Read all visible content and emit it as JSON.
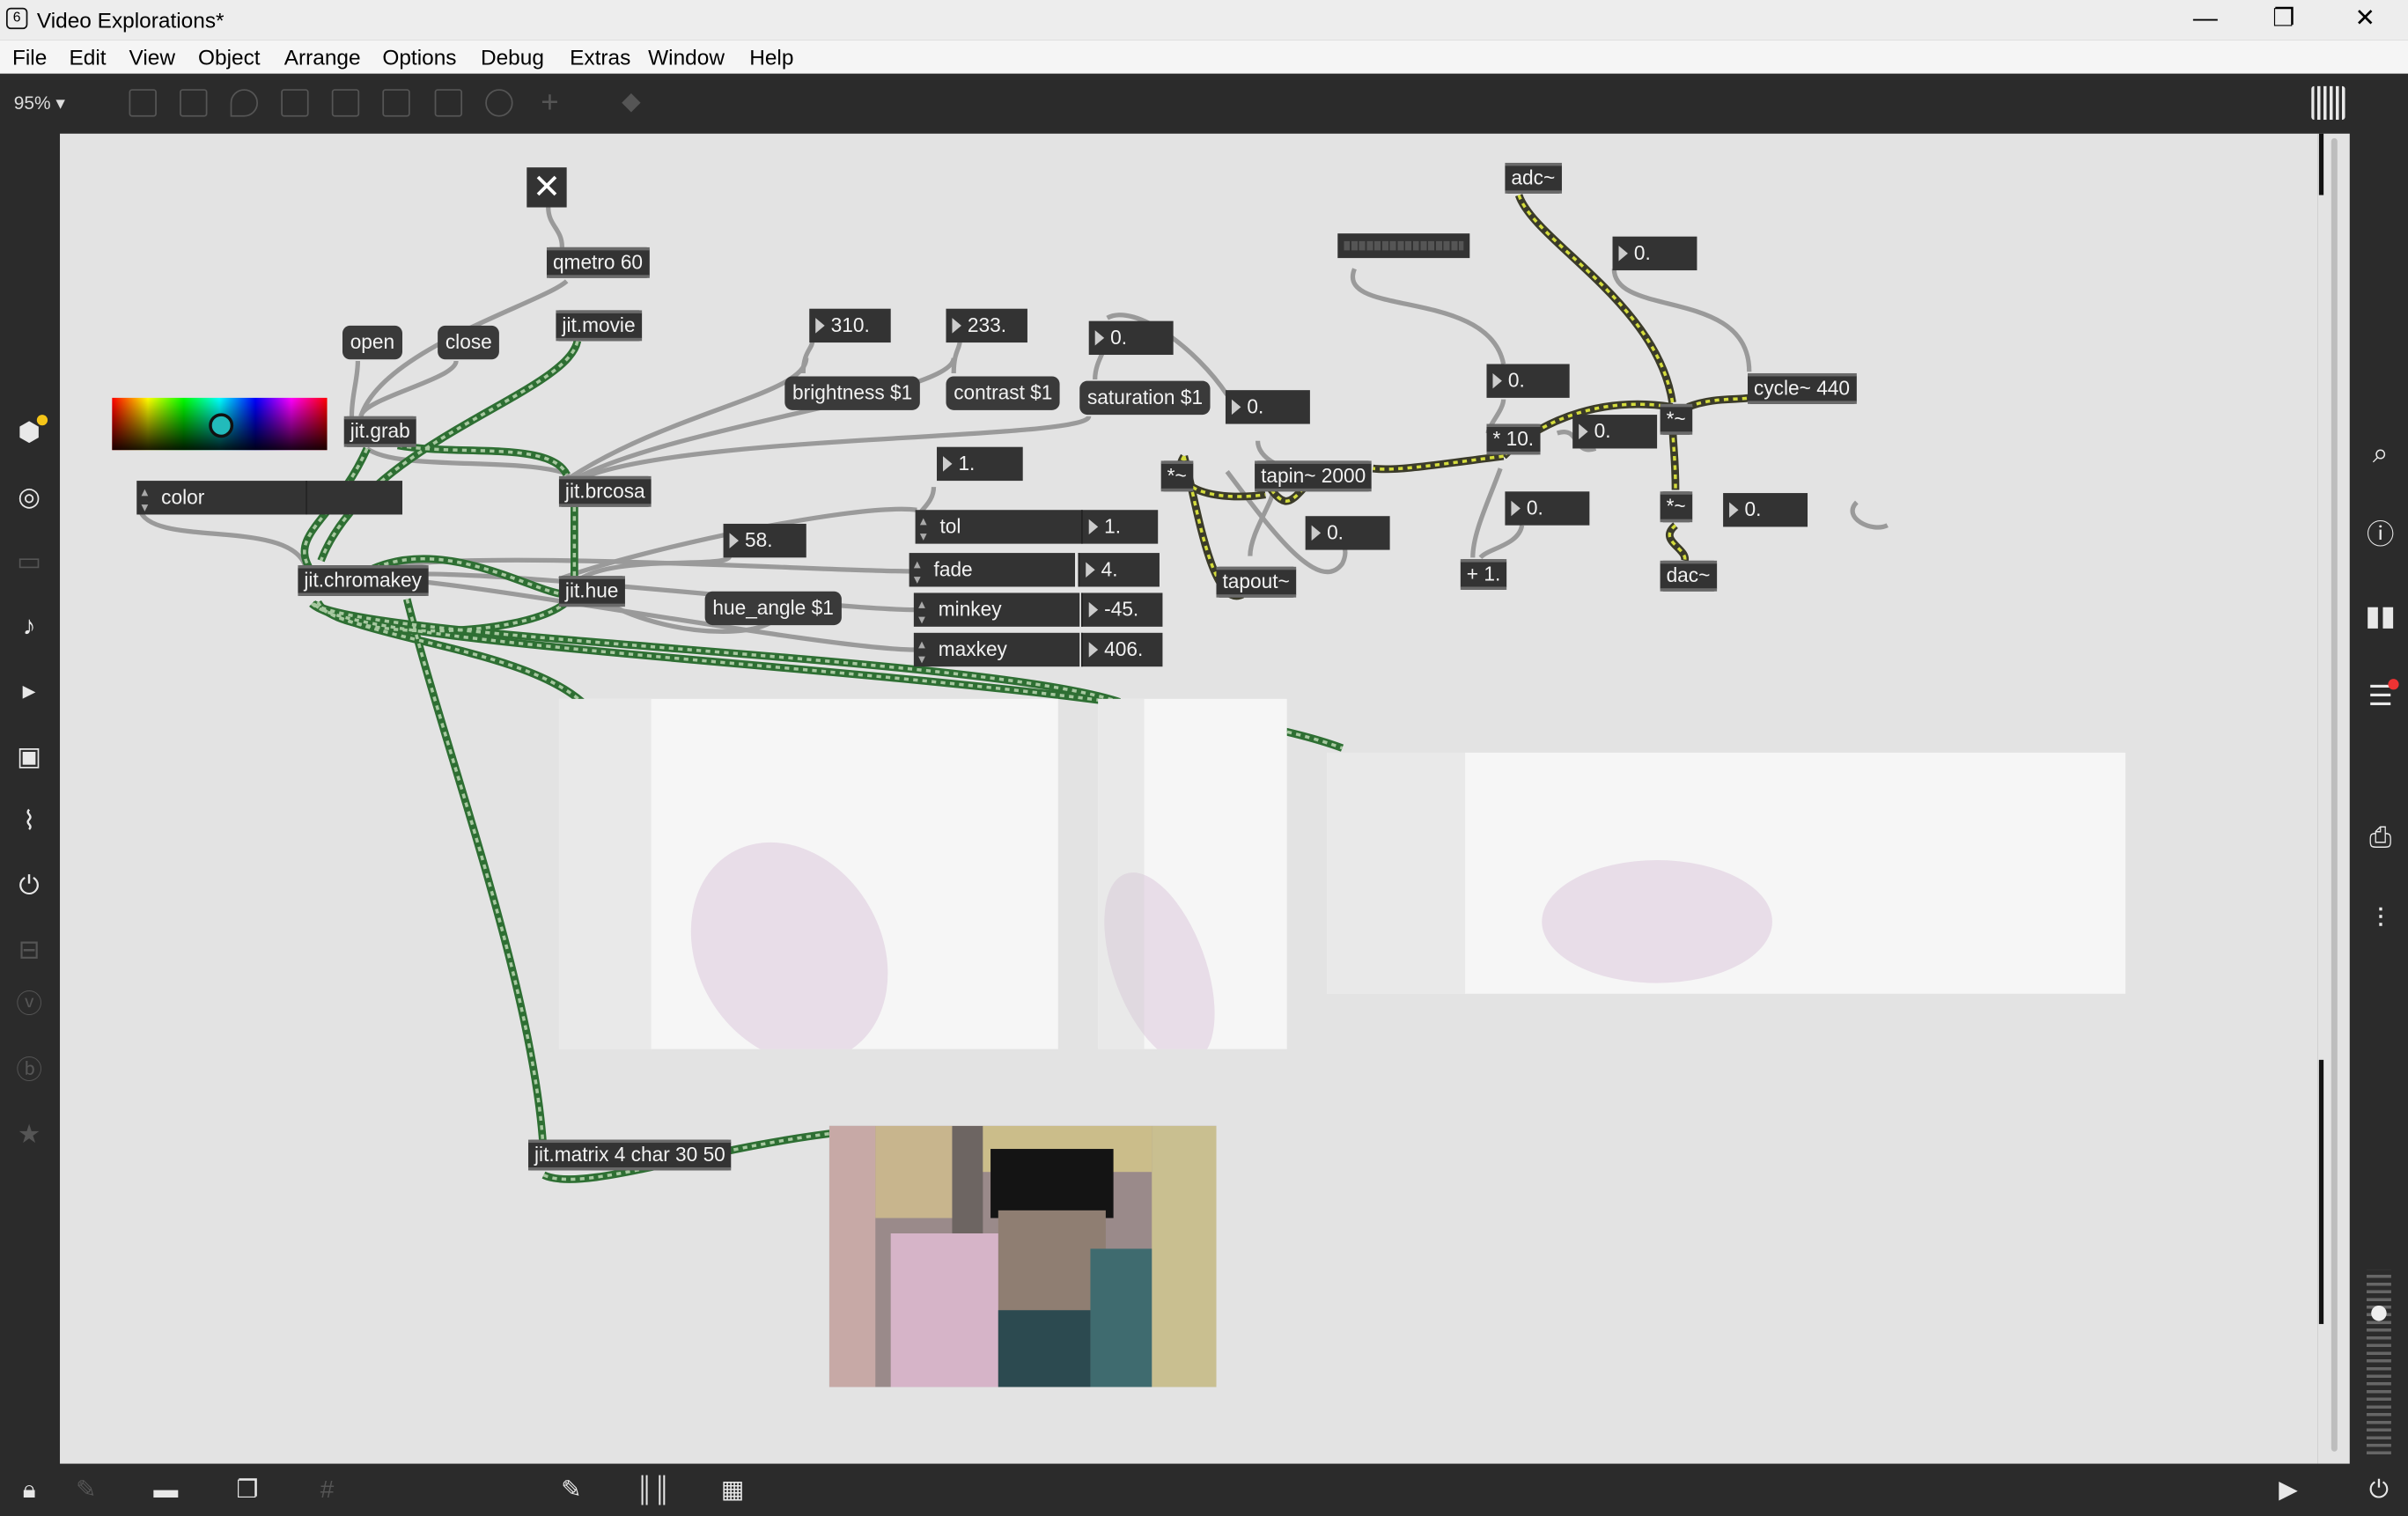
{
  "window": {
    "title": "Video Explorations*",
    "minimize": "—",
    "maximize": "❐",
    "close": "✕"
  },
  "menu": [
    "File",
    "Edit",
    "View",
    "Object",
    "Arrange",
    "Options",
    "Debug",
    "Extras",
    "Window",
    "Help"
  ],
  "toolbar": {
    "zoom": "95% ▾"
  },
  "patch": {
    "toggle": "✕",
    "qmetro": "qmetro 60",
    "jit_movie": "jit.movie",
    "open_msg": "open",
    "close_msg": "close",
    "jit_grab": "jit.grab",
    "color_attr": "color",
    "jit_brcosa": "jit.brcosa",
    "jit_chromakey": "jit.chromakey",
    "jit_hue": "jit.hue",
    "num_310": "310.",
    "num_233": "233.",
    "num_sat": "0.",
    "brightness_msg": "brightness $1",
    "contrast_msg": "contrast $1",
    "saturation_msg": "saturation $1",
    "num_58": "58.",
    "hue_angle_msg": "hue_angle $1",
    "num_tol_in": "1.",
    "tol_label": "tol",
    "tol_value": "1.",
    "fade_label": "fade",
    "fade_value": "4.",
    "minkey_label": "minkey",
    "minkey_value": "-45.",
    "maxkey_label": "maxkey",
    "maxkey_value": "406.",
    "jit_matrix": "jit.matrix 4 char 30 50",
    "adc": "adc~",
    "num_a": "0.",
    "num_b": "0.",
    "num_c": "0.",
    "num_d": "0.",
    "num_e": "0.",
    "num_f": "0.",
    "num_g": "0.",
    "num_h": "0.",
    "mul_sig1": "*~",
    "tapin": "tapin~ 2000",
    "tapout": "tapout~",
    "mul_10": "* 10.",
    "plus_1": "+ 1.",
    "mul_sig2": "*~",
    "mul_sig3": "*~",
    "cycle": "cycle~ 440",
    "dac": "dac~"
  },
  "colors": {
    "canvas": "#e3e3e3",
    "object": "#333333",
    "cord_signal": "#c8d23a",
    "cord_matrix": "#2e8b3e",
    "cord_plain": "#9a9a9a",
    "chrome": "#2b2b2b"
  },
  "icons": {
    "left": [
      "package-icon",
      "circle-target-icon",
      "film-icon",
      "music-note-icon",
      "play-list-icon",
      "image-icon",
      "paperclip-icon",
      "plugin-icon",
      "pill-icon",
      "v-badge-icon",
      "b-badge-icon",
      "star-icon"
    ],
    "right": [
      "search-icon",
      "info-icon",
      "book-icon",
      "list-icon",
      "camera-icon",
      "sliders-icon"
    ],
    "bottom": [
      "lock-icon",
      "edit-icon",
      "presentation-icon",
      "windows-icon",
      "grid-icon",
      "wrench-icon",
      "keyboard-icon",
      "piano-icon",
      "play-circle-icon",
      "power-icon"
    ]
  }
}
